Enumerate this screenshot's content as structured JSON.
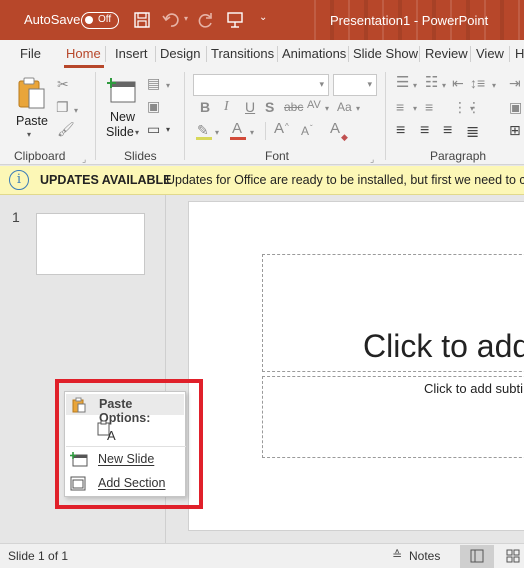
{
  "titlebar": {
    "autosave_label": "AutoSave",
    "autosave_state": "Off",
    "title": "Presentation1  -  PowerPoint",
    "background_color": "#b7472a"
  },
  "tabs": [
    "File",
    "Home",
    "Insert",
    "Design",
    "Transitions",
    "Animations",
    "Slide Show",
    "Review",
    "View",
    "H"
  ],
  "active_tab": "Home",
  "ribbon": {
    "clipboard": {
      "paste_label": "Paste",
      "group_label": "Clipboard"
    },
    "slides": {
      "new_slide_label_1": "New",
      "new_slide_label_2": "Slide",
      "group_label": "Slides"
    },
    "font": {
      "group_label": "Font",
      "bold": "B",
      "italic": "I",
      "underline": "U",
      "strike": "S",
      "spacing": "AV",
      "case": "Aa",
      "grow": "A",
      "shrink": "A",
      "clear": "A",
      "color_a": "A"
    },
    "paragraph": {
      "group_label": "Paragraph"
    }
  },
  "infobar": {
    "title": "UPDATES AVAILABLE",
    "message": "Updates for Office are ready to be installed, but first we need to close",
    "background_color": "#fcf7b6"
  },
  "thumbnails": [
    {
      "number": "1"
    }
  ],
  "slide": {
    "title_placeholder": "Click to add",
    "subtitle_placeholder": "Click to add subti"
  },
  "context_menu": {
    "header": "Paste Options:",
    "paste_glyph": "A",
    "items": [
      {
        "label": "New Slide",
        "underline_char": "N"
      },
      {
        "label": "Add Section",
        "underline_char": "A"
      }
    ]
  },
  "status": {
    "slide_info": "Slide 1 of 1",
    "notes_label": "Notes"
  },
  "highlight_color": "#e0202a"
}
